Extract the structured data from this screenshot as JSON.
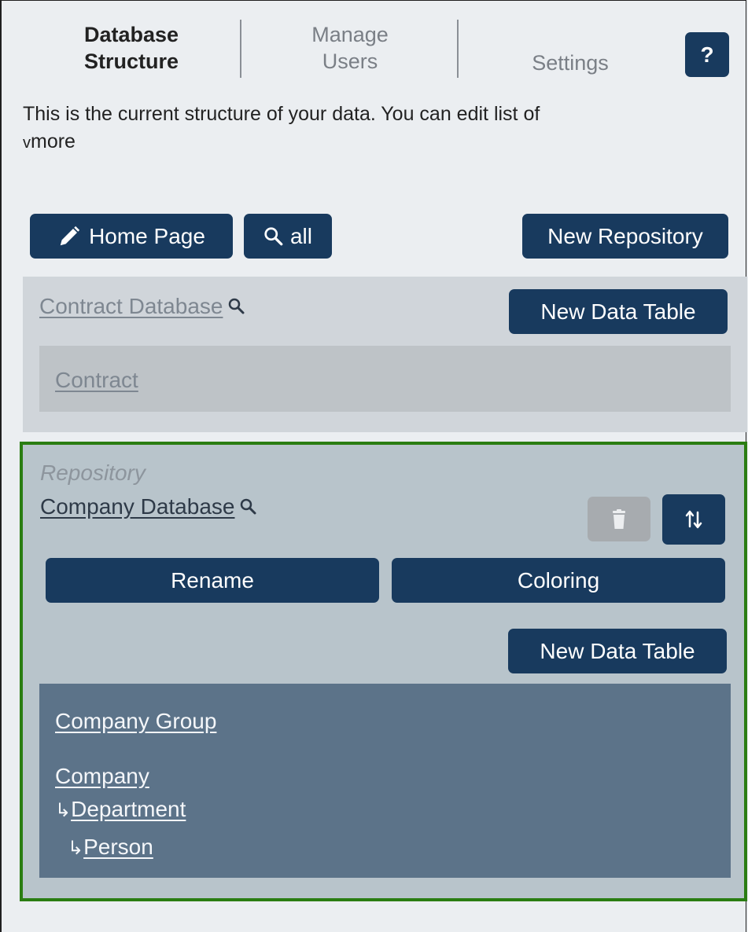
{
  "tabs": [
    {
      "line1": "Database",
      "line2": "Structure"
    },
    {
      "line1": "Manage",
      "line2": "Users"
    },
    {
      "line1": "Settings"
    }
  ],
  "help_label": "?",
  "intro": {
    "text": "This is the current structure of your data. You can edit list of",
    "more_arrow": "v",
    "more_label": "more"
  },
  "toolbar": {
    "home_page_label": "Home Page",
    "search_all_label": "all",
    "new_repository_label": "New Repository"
  },
  "repositories": [
    {
      "name": "Contract Database",
      "new_table_label": "New Data Table",
      "tables": [
        "Contract"
      ]
    },
    {
      "type_label": "Repository",
      "name": "Company Database",
      "rename_label": "Rename",
      "coloring_label": "Coloring",
      "new_table_label": "New Data Table",
      "tables": {
        "group": "Company Group",
        "company": "Company",
        "department": "Department",
        "person": "Person",
        "child_arrow": "↳"
      }
    }
  ],
  "colors": {
    "primary_button": "#183a5e",
    "selected_border": "#2a7d12",
    "selected_panel": "#b8c4cb",
    "tables_panel": "#5c7389"
  }
}
